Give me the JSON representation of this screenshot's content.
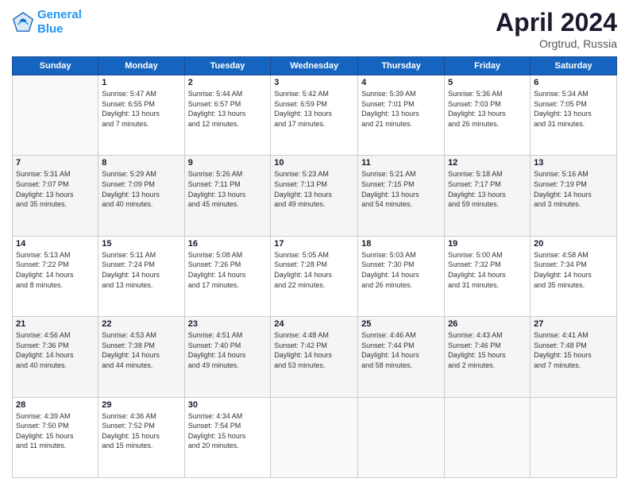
{
  "header": {
    "logo_line1": "General",
    "logo_line2": "Blue",
    "title": "April 2024",
    "subtitle": "Orgtrud, Russia"
  },
  "weekdays": [
    "Sunday",
    "Monday",
    "Tuesday",
    "Wednesday",
    "Thursday",
    "Friday",
    "Saturday"
  ],
  "weeks": [
    [
      {
        "day": "",
        "info": ""
      },
      {
        "day": "1",
        "info": "Sunrise: 5:47 AM\nSunset: 6:55 PM\nDaylight: 13 hours\nand 7 minutes."
      },
      {
        "day": "2",
        "info": "Sunrise: 5:44 AM\nSunset: 6:57 PM\nDaylight: 13 hours\nand 12 minutes."
      },
      {
        "day": "3",
        "info": "Sunrise: 5:42 AM\nSunset: 6:59 PM\nDaylight: 13 hours\nand 17 minutes."
      },
      {
        "day": "4",
        "info": "Sunrise: 5:39 AM\nSunset: 7:01 PM\nDaylight: 13 hours\nand 21 minutes."
      },
      {
        "day": "5",
        "info": "Sunrise: 5:36 AM\nSunset: 7:03 PM\nDaylight: 13 hours\nand 26 minutes."
      },
      {
        "day": "6",
        "info": "Sunrise: 5:34 AM\nSunset: 7:05 PM\nDaylight: 13 hours\nand 31 minutes."
      }
    ],
    [
      {
        "day": "7",
        "info": "Sunrise: 5:31 AM\nSunset: 7:07 PM\nDaylight: 13 hours\nand 35 minutes."
      },
      {
        "day": "8",
        "info": "Sunrise: 5:29 AM\nSunset: 7:09 PM\nDaylight: 13 hours\nand 40 minutes."
      },
      {
        "day": "9",
        "info": "Sunrise: 5:26 AM\nSunset: 7:11 PM\nDaylight: 13 hours\nand 45 minutes."
      },
      {
        "day": "10",
        "info": "Sunrise: 5:23 AM\nSunset: 7:13 PM\nDaylight: 13 hours\nand 49 minutes."
      },
      {
        "day": "11",
        "info": "Sunrise: 5:21 AM\nSunset: 7:15 PM\nDaylight: 13 hours\nand 54 minutes."
      },
      {
        "day": "12",
        "info": "Sunrise: 5:18 AM\nSunset: 7:17 PM\nDaylight: 13 hours\nand 59 minutes."
      },
      {
        "day": "13",
        "info": "Sunrise: 5:16 AM\nSunset: 7:19 PM\nDaylight: 14 hours\nand 3 minutes."
      }
    ],
    [
      {
        "day": "14",
        "info": "Sunrise: 5:13 AM\nSunset: 7:22 PM\nDaylight: 14 hours\nand 8 minutes."
      },
      {
        "day": "15",
        "info": "Sunrise: 5:11 AM\nSunset: 7:24 PM\nDaylight: 14 hours\nand 13 minutes."
      },
      {
        "day": "16",
        "info": "Sunrise: 5:08 AM\nSunset: 7:26 PM\nDaylight: 14 hours\nand 17 minutes."
      },
      {
        "day": "17",
        "info": "Sunrise: 5:05 AM\nSunset: 7:28 PM\nDaylight: 14 hours\nand 22 minutes."
      },
      {
        "day": "18",
        "info": "Sunrise: 5:03 AM\nSunset: 7:30 PM\nDaylight: 14 hours\nand 26 minutes."
      },
      {
        "day": "19",
        "info": "Sunrise: 5:00 AM\nSunset: 7:32 PM\nDaylight: 14 hours\nand 31 minutes."
      },
      {
        "day": "20",
        "info": "Sunrise: 4:58 AM\nSunset: 7:34 PM\nDaylight: 14 hours\nand 35 minutes."
      }
    ],
    [
      {
        "day": "21",
        "info": "Sunrise: 4:56 AM\nSunset: 7:36 PM\nDaylight: 14 hours\nand 40 minutes."
      },
      {
        "day": "22",
        "info": "Sunrise: 4:53 AM\nSunset: 7:38 PM\nDaylight: 14 hours\nand 44 minutes."
      },
      {
        "day": "23",
        "info": "Sunrise: 4:51 AM\nSunset: 7:40 PM\nDaylight: 14 hours\nand 49 minutes."
      },
      {
        "day": "24",
        "info": "Sunrise: 4:48 AM\nSunset: 7:42 PM\nDaylight: 14 hours\nand 53 minutes."
      },
      {
        "day": "25",
        "info": "Sunrise: 4:46 AM\nSunset: 7:44 PM\nDaylight: 14 hours\nand 58 minutes."
      },
      {
        "day": "26",
        "info": "Sunrise: 4:43 AM\nSunset: 7:46 PM\nDaylight: 15 hours\nand 2 minutes."
      },
      {
        "day": "27",
        "info": "Sunrise: 4:41 AM\nSunset: 7:48 PM\nDaylight: 15 hours\nand 7 minutes."
      }
    ],
    [
      {
        "day": "28",
        "info": "Sunrise: 4:39 AM\nSunset: 7:50 PM\nDaylight: 15 hours\nand 11 minutes."
      },
      {
        "day": "29",
        "info": "Sunrise: 4:36 AM\nSunset: 7:52 PM\nDaylight: 15 hours\nand 15 minutes."
      },
      {
        "day": "30",
        "info": "Sunrise: 4:34 AM\nSunset: 7:54 PM\nDaylight: 15 hours\nand 20 minutes."
      },
      {
        "day": "",
        "info": ""
      },
      {
        "day": "",
        "info": ""
      },
      {
        "day": "",
        "info": ""
      },
      {
        "day": "",
        "info": ""
      }
    ]
  ]
}
